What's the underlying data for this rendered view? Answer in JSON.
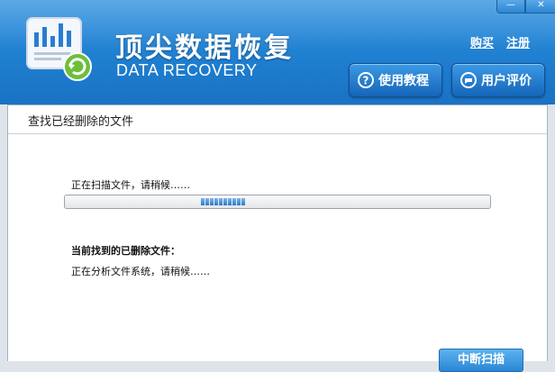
{
  "header": {
    "title": "顶尖数据恢复",
    "subtitle": "DATA RECOVERY",
    "links": {
      "buy": "购买",
      "register": "注册"
    },
    "buttons": {
      "tutorial": {
        "label": "使用教程",
        "icon": "question-icon"
      },
      "reviews": {
        "label": "用户评价",
        "icon": "chat-bubble-icon"
      }
    },
    "window_controls": {
      "minimize": "minimize-icon",
      "close": "close-icon"
    }
  },
  "main": {
    "title": "查找已经删除的文件",
    "scan_status": "正在扫描文件，请稍候……",
    "found_label": "当前找到的已删除文件：",
    "analyze_status": "正在分析文件系统，请稍候……",
    "progress": {
      "style": "marquee",
      "indeterminate": true
    },
    "stop_button": "中断扫描"
  },
  "colors": {
    "header_blue": "#1f7fd0",
    "button_blue": "#1565b8",
    "progress_blue": "#2a79c8"
  }
}
